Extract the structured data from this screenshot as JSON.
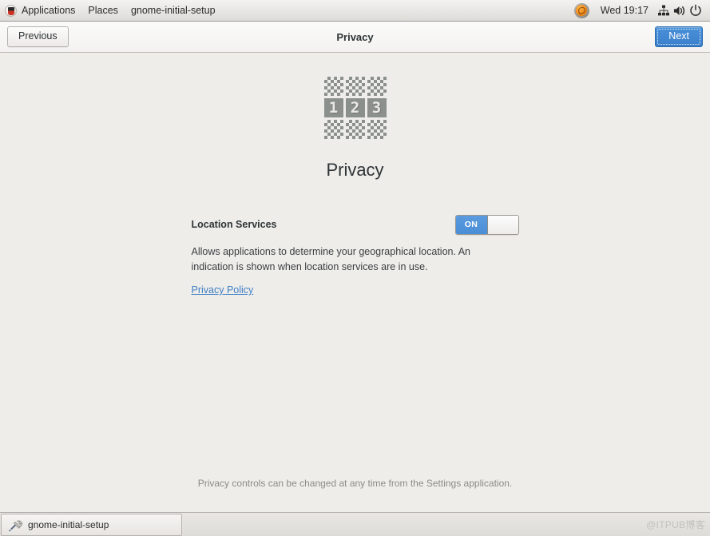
{
  "top_panel": {
    "menus": [
      {
        "label": "Applications",
        "icon": "fedora-logo-icon"
      },
      {
        "label": "Places"
      },
      {
        "label": "gnome-initial-setup"
      }
    ],
    "status": {
      "notification_icon": "software-update-icon",
      "clock": "Wed 19:17",
      "network_icon": "network-wired-icon",
      "volume_icon": "volume-high-icon",
      "power_icon": "power-icon"
    }
  },
  "headerbar": {
    "previous_label": "Previous",
    "title": "Privacy",
    "next_label": "Next"
  },
  "main": {
    "icon": {
      "name": "privacy-pixel-icon",
      "digits": [
        "1",
        "2",
        "3"
      ]
    },
    "page_title": "Privacy",
    "location_services": {
      "label": "Location Services",
      "switch_state": "ON",
      "switch_on_label": "ON",
      "description": "Allows applications to determine your geographical location. An indication is shown when location services are in use.",
      "privacy_policy_link": "Privacy Policy"
    },
    "footnote": "Privacy controls can be changed at any time from the Settings application."
  },
  "taskbar": {
    "items": [
      {
        "label": "gnome-initial-setup",
        "icon": "tools-icon"
      }
    ]
  },
  "watermark": {
    "text": "@ITPUB",
    "suffix": "博客"
  },
  "colors": {
    "accent_blue": "#4a90d9",
    "link_blue": "#3c7fc4",
    "content_bg": "#efedea",
    "panel_bg": "#e8e6e3",
    "icon_gray": "#8b908d",
    "title_text": "#2e3436"
  }
}
